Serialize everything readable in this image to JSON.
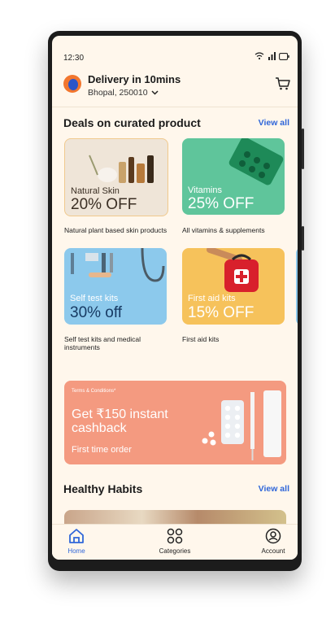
{
  "status_bar": {
    "time": "12:30"
  },
  "header": {
    "delivery_title": "Delivery in 10mins",
    "address": "Bhopal, 250010"
  },
  "deals": {
    "title": "Deals on curated product",
    "view_all": "View all",
    "cards": [
      {
        "label": "Natural Skin",
        "offer": "20% OFF",
        "description": "Natural plant based skin products",
        "bg": "#EFE5D8"
      },
      {
        "label": "Vitamins",
        "offer": "25% OFF",
        "description": "All vitamins & supplements",
        "bg": "#5FC59B"
      },
      {
        "label": "Self test kits",
        "offer": "30% off",
        "description": "Self test kits and medical instruments",
        "bg": "#8CC9EC"
      },
      {
        "label": "First aid kits",
        "offer": "15% OFF",
        "description": "First aid kits",
        "bg": "#F6C25B"
      }
    ],
    "carousel": {
      "pages": 3,
      "active_page": 1
    }
  },
  "banner": {
    "terms": "Terms & Conditions*",
    "headline": "Get ₹150 instant cashback",
    "subtext": "First time order",
    "bg": "#F49A80"
  },
  "healthy_habits": {
    "title": "Healthy Habits",
    "view_all": "View all"
  },
  "tabs": [
    {
      "label": "Home",
      "icon": "home-icon",
      "active": true
    },
    {
      "label": "Categories",
      "icon": "categories-icon",
      "active": false
    },
    {
      "label": "Account",
      "icon": "account-icon",
      "active": false
    }
  ],
  "colors": {
    "accent": "#2F66D9",
    "background": "#FFF7EC"
  }
}
